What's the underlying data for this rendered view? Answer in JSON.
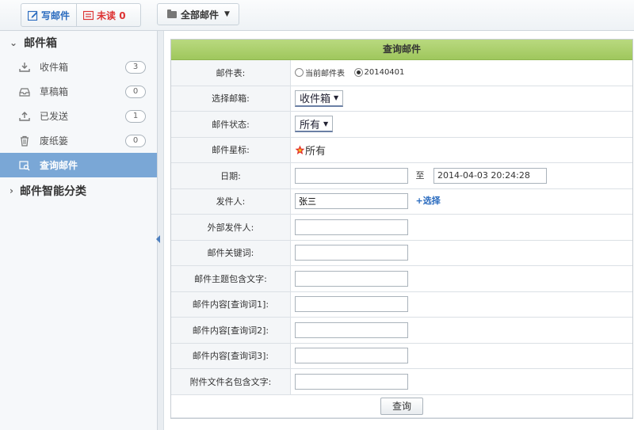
{
  "toolbar": {
    "compose_label": "写邮件",
    "unread_label": "未读 0",
    "folder_label": "全部邮件"
  },
  "sidebar": {
    "mailbox_title": "邮件箱",
    "items": [
      {
        "label": "收件箱",
        "count": "3",
        "icon": "inbox-download-icon"
      },
      {
        "label": "草稿箱",
        "count": "0",
        "icon": "drafts-tray-icon"
      },
      {
        "label": "已发送",
        "count": "1",
        "icon": "upload-sent-icon"
      },
      {
        "label": "废纸篓",
        "count": "0",
        "icon": "trash-icon"
      },
      {
        "label": "查询邮件",
        "count": "",
        "icon": "search-mail-icon"
      }
    ],
    "smart_title": "邮件智能分类"
  },
  "form": {
    "title": "查询邮件",
    "rows": {
      "table_label": "邮件表:",
      "table_opt1": "当前邮件表",
      "table_opt2": "20140401",
      "mailbox_label": "选择邮箱:",
      "mailbox_value": "收件箱",
      "status_label": "邮件状态:",
      "status_value": "所有",
      "star_label": "邮件星标:",
      "star_value": "所有",
      "date_label": "日期:",
      "date_from": "",
      "date_to_label": "至",
      "date_to": "2014-04-03 20:24:28",
      "sender_label": "发件人:",
      "sender_value": "张三",
      "choose_label": "+选择",
      "ext_sender_label": "外部发件人:",
      "keyword_label": "邮件关键词:",
      "subject_label": "邮件主题包含文字:",
      "content1_label": "邮件内容[查询词1]:",
      "content2_label": "邮件内容[查询词2]:",
      "content3_label": "邮件内容[查询词3]:",
      "attachment_label": "附件文件名包含文字:"
    },
    "submit_label": "查询"
  },
  "colors": {
    "accent_blue": "#7aa7d6",
    "panel_header_green": "#a8cf66",
    "unread_red": "#d33333"
  }
}
